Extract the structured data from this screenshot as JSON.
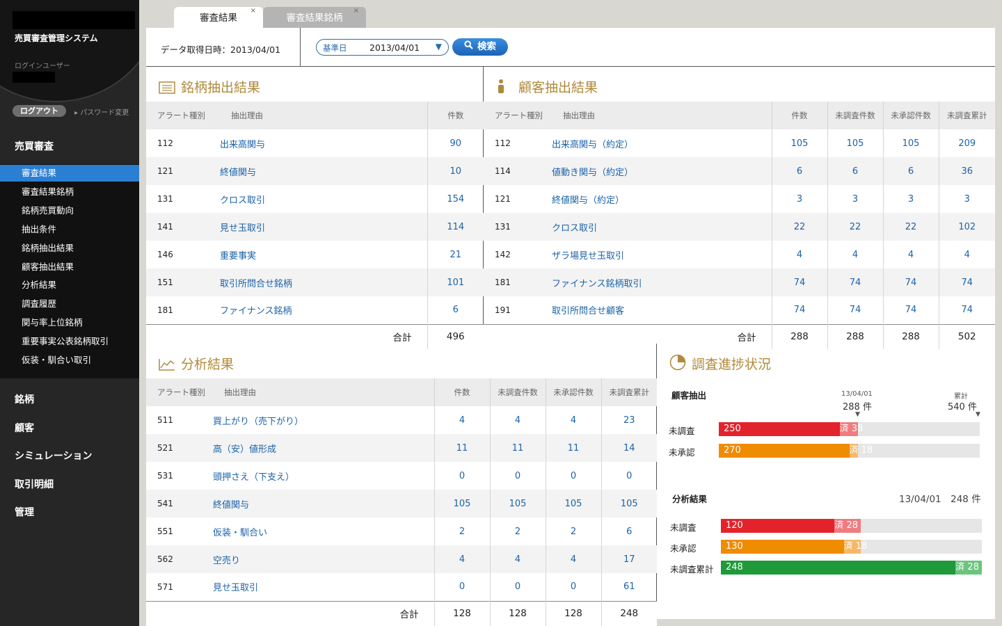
{
  "app": {
    "system_name": "売買審査管理システム",
    "login_user_label": "ログインユーザー",
    "logout_label": "ログアウト",
    "password_change_label": "パスワード変更"
  },
  "nav": {
    "section_review": "売買審査",
    "sub_items": [
      "審査結果",
      "審査結果銘柄",
      "銘柄売買動向",
      "抽出条件",
      "銘柄抽出結果",
      "顧客抽出結果",
      "分析結果",
      "調査履歴",
      "関与率上位銘柄",
      "重要事実公表銘柄取引",
      "仮装・馴合い取引"
    ],
    "active_index": 0,
    "sections": [
      "銘柄",
      "顧客",
      "シミュレーション",
      "取引明細",
      "管理"
    ]
  },
  "tabs": [
    {
      "label": "審査結果",
      "active": true,
      "close": "×"
    },
    {
      "label": "審査結果銘柄",
      "active": false,
      "close": "×"
    }
  ],
  "toolbar": {
    "fetch_text": "データ取得日時：2013/04/01",
    "date_key": "基準日",
    "date_value": "2013/04/01",
    "dropdown_arrow": "▼",
    "search_label": "検索",
    "search_icon": "search-icon"
  },
  "stock_panel": {
    "title": "銘柄抽出結果",
    "icon": "list-icon",
    "headers": [
      "アラート種別",
      "抽出理由",
      "件数"
    ],
    "rows": [
      {
        "code": "112",
        "reason": "出来高関与",
        "count": "90"
      },
      {
        "code": "121",
        "reason": "終値関与",
        "count": "10"
      },
      {
        "code": "131",
        "reason": "クロス取引",
        "count": "154"
      },
      {
        "code": "141",
        "reason": "見せ玉取引",
        "count": "114"
      },
      {
        "code": "146",
        "reason": "重要事実",
        "count": "21"
      },
      {
        "code": "151",
        "reason": "取引所問合せ銘柄",
        "count": "101"
      },
      {
        "code": "181",
        "reason": "ファイナンス銘柄",
        "count": "6"
      }
    ],
    "total_label": "合計",
    "total": "496"
  },
  "customer_panel": {
    "title": "顧客抽出結果",
    "icon": "person-icon",
    "headers": [
      "アラート種別",
      "抽出理由",
      "件数",
      "未調査件数",
      "未承認件数",
      "未調査累計"
    ],
    "rows": [
      {
        "code": "112",
        "reason": "出来高関与（約定）",
        "c1": "105",
        "c2": "105",
        "c3": "105",
        "c4": "209"
      },
      {
        "code": "114",
        "reason": "値動き関与（約定）",
        "c1": "6",
        "c2": "6",
        "c3": "6",
        "c4": "36"
      },
      {
        "code": "121",
        "reason": "終値関与（約定）",
        "c1": "3",
        "c2": "3",
        "c3": "3",
        "c4": "3"
      },
      {
        "code": "131",
        "reason": "クロス取引",
        "c1": "22",
        "c2": "22",
        "c3": "22",
        "c4": "102"
      },
      {
        "code": "142",
        "reason": "ザラ場見せ玉取引",
        "c1": "4",
        "c2": "4",
        "c3": "4",
        "c4": "4"
      },
      {
        "code": "181",
        "reason": "ファイナンス銘柄取引",
        "c1": "74",
        "c2": "74",
        "c3": "74",
        "c4": "74"
      },
      {
        "code": "191",
        "reason": "取引所問合せ顧客",
        "c1": "74",
        "c2": "74",
        "c3": "74",
        "c4": "74"
      }
    ],
    "total_label": "合計",
    "totals": [
      "288",
      "288",
      "288",
      "502"
    ]
  },
  "analysis_panel": {
    "title": "分析結果",
    "icon": "line-chart-icon",
    "headers": [
      "アラート種別",
      "抽出理由",
      "件数",
      "未調査件数",
      "未承認件数",
      "未調査累計"
    ],
    "rows": [
      {
        "code": "511",
        "reason": "買上がり（売下がり）",
        "c1": "4",
        "c2": "4",
        "c3": "4",
        "c4": "23"
      },
      {
        "code": "521",
        "reason": "高（安）値形成",
        "c1": "11",
        "c2": "11",
        "c3": "11",
        "c4": "14"
      },
      {
        "code": "531",
        "reason": "頭押さえ（下支え）",
        "c1": "0",
        "c2": "0",
        "c3": "0",
        "c4": "0"
      },
      {
        "code": "541",
        "reason": "終値関与",
        "c1": "105",
        "c2": "105",
        "c3": "105",
        "c4": "105"
      },
      {
        "code": "551",
        "reason": "仮装・馴合い",
        "c1": "2",
        "c2": "2",
        "c3": "2",
        "c4": "6"
      },
      {
        "code": "562",
        "reason": "空売り",
        "c1": "4",
        "c2": "4",
        "c3": "4",
        "c4": "17"
      },
      {
        "code": "571",
        "reason": "見せ玉取引",
        "c1": "0",
        "c2": "0",
        "c3": "0",
        "c4": "61"
      }
    ],
    "total_label": "合計",
    "totals": [
      "128",
      "128",
      "128",
      "248"
    ]
  },
  "progress_panel": {
    "title": "調査進捗状況",
    "icon": "pie-chart-icon",
    "customer": {
      "heading": "顧客抽出",
      "date": "13/04/01",
      "date_count": "288 件",
      "cumulative_label": "累計",
      "cumulative_count": "540 件",
      "marker": "▼",
      "scale_max": 540,
      "bars": [
        {
          "label": "未調査",
          "value": 250,
          "value_text": "250",
          "done": 38,
          "done_text": "済 38",
          "color": "#e3232b",
          "done_color": "#f07c80"
        },
        {
          "label": "未承認",
          "value": 270,
          "value_text": "270",
          "done": 18,
          "done_text": "済 18",
          "color": "#f08c00",
          "done_color": "#f6b866"
        }
      ]
    },
    "analysis": {
      "heading": "分析結果",
      "date_text": "13/04/01　248 件",
      "scale_max": 276,
      "bars": [
        {
          "label": "未調査",
          "value": 120,
          "value_text": "120",
          "done": 28,
          "done_text": "済 28",
          "color": "#e3232b",
          "done_color": "#f07c80"
        },
        {
          "label": "未承認",
          "value": 130,
          "value_text": "130",
          "done": 18,
          "done_text": "済 18",
          "color": "#f08c00",
          "done_color": "#f6b866"
        },
        {
          "label": "未調査累計",
          "value": 248,
          "value_text": "248",
          "done": 28,
          "done_text": "済 28",
          "color": "#1e9a3a",
          "done_color": "#6cc47f"
        }
      ]
    }
  }
}
